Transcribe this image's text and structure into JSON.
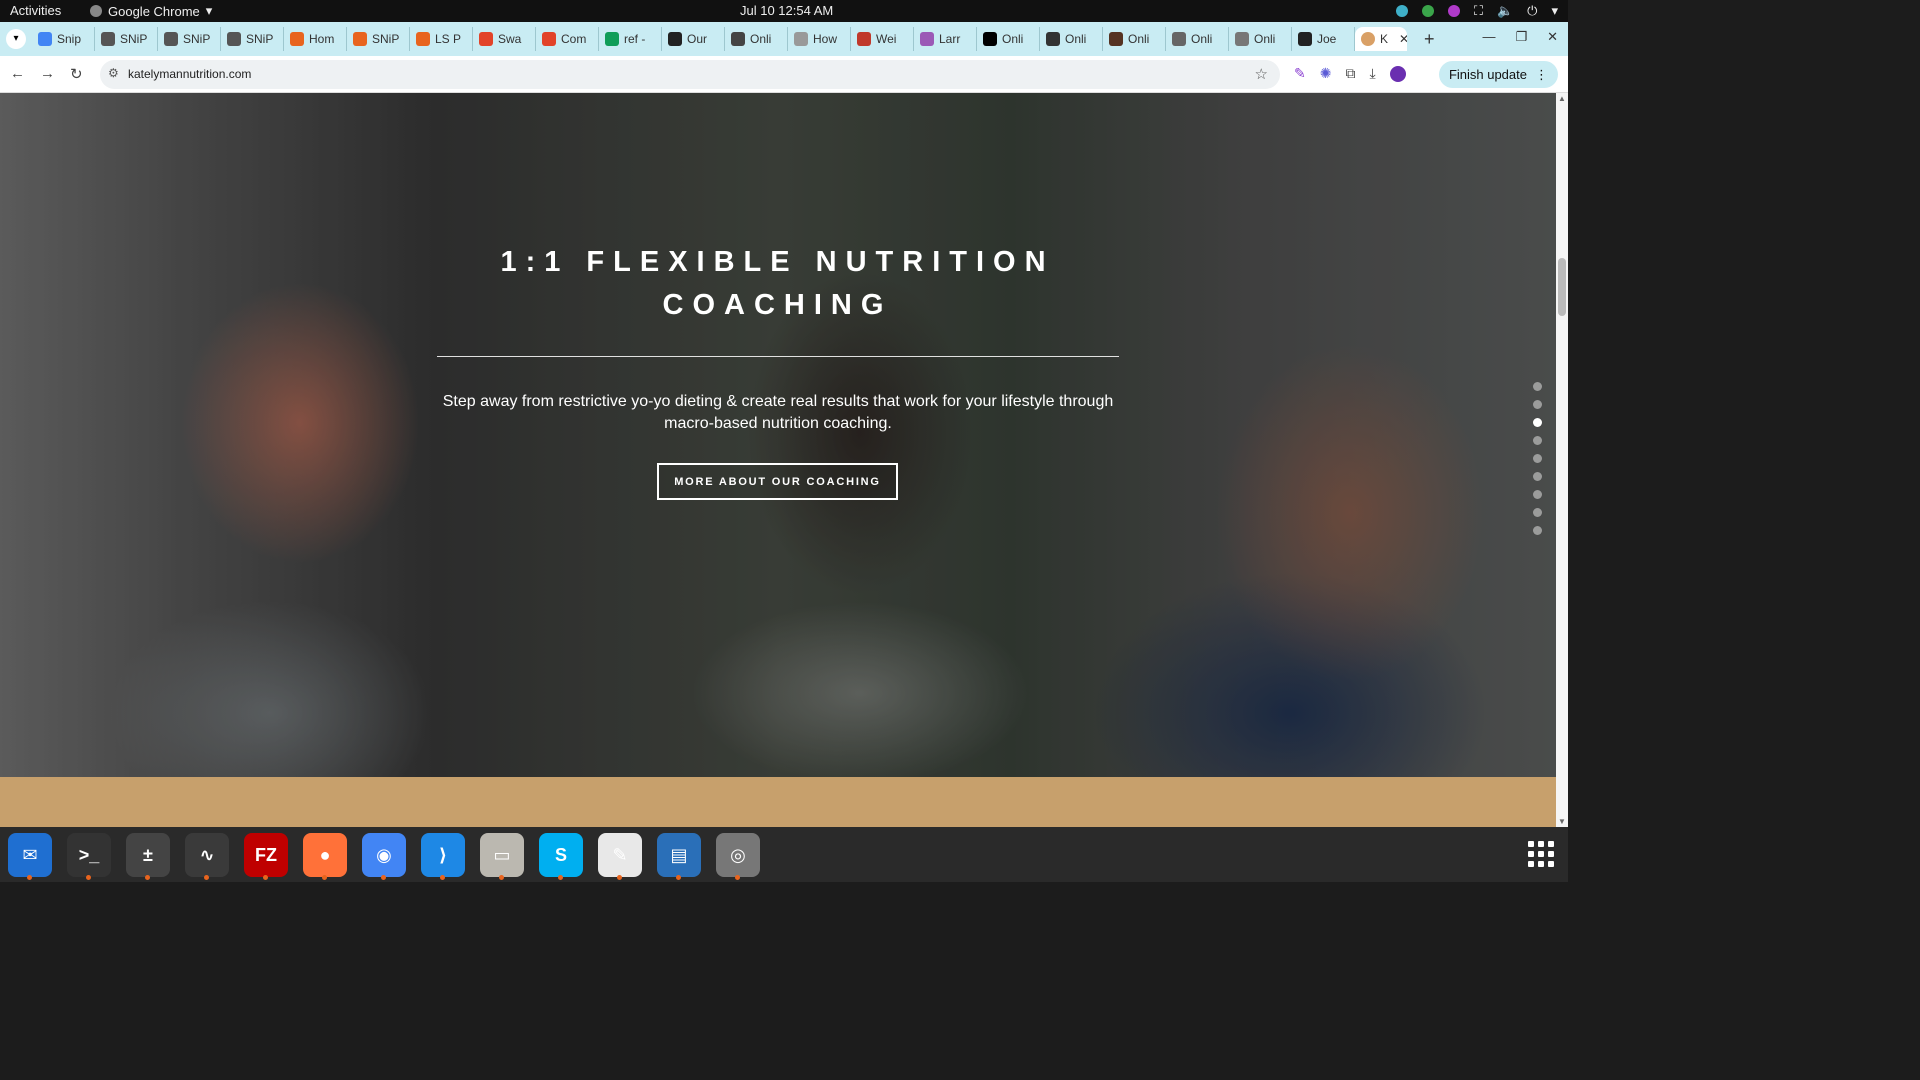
{
  "system_bar": {
    "activities": "Activities",
    "app_name": "Google Chrome",
    "clock": "Jul 10  12:54 AM"
  },
  "tabs": [
    {
      "label": "Snip",
      "color": "#4285f4"
    },
    {
      "label": "SNiP",
      "color": "#555555"
    },
    {
      "label": "SNiP",
      "color": "#555555"
    },
    {
      "label": "SNiP",
      "color": "#555555"
    },
    {
      "label": "Hom",
      "color": "#e8641e"
    },
    {
      "label": "SNiP",
      "color": "#e8641e"
    },
    {
      "label": "LS P",
      "color": "#e8641e"
    },
    {
      "label": "Swa",
      "color": "#e24329"
    },
    {
      "label": "Com",
      "color": "#e24329"
    },
    {
      "label": "ref -",
      "color": "#0f9d58"
    },
    {
      "label": "Our",
      "color": "#222222"
    },
    {
      "label": "Onli",
      "color": "#444444"
    },
    {
      "label": "How",
      "color": "#999999"
    },
    {
      "label": "Wei",
      "color": "#c0392b"
    },
    {
      "label": "Larr",
      "color": "#9b59b6"
    },
    {
      "label": "Onli",
      "color": "#000000"
    },
    {
      "label": "Onli",
      "color": "#333333"
    },
    {
      "label": "Onli",
      "color": "#553322"
    },
    {
      "label": "Onli",
      "color": "#666666"
    },
    {
      "label": "Onli",
      "color": "#777777"
    },
    {
      "label": "Joe",
      "color": "#222222"
    }
  ],
  "active_tab": {
    "label": "K",
    "color": "#d9a066"
  },
  "address_bar": {
    "url": "katelymannutrition.com"
  },
  "finish_update": "Finish update",
  "hero": {
    "title": "1:1 FLEXIBLE NUTRITION COACHING",
    "description": "Step away from restrictive yo-yo dieting & create real results that work for your lifestyle through macro-based nutrition coaching.",
    "button": "MORE ABOUT OUR COACHING"
  },
  "slide_dots": {
    "count": 9,
    "active_index": 2
  },
  "dock": [
    {
      "name": "thunderbird-icon",
      "color": "#1f6fd1",
      "glyph": "✉"
    },
    {
      "name": "terminal-icon",
      "color": "#333333",
      "glyph": ">_"
    },
    {
      "name": "calculator-icon",
      "color": "#444444",
      "glyph": "±"
    },
    {
      "name": "system-monitor-icon",
      "color": "#3a3a3a",
      "glyph": "∿"
    },
    {
      "name": "filezilla-icon",
      "color": "#bf0000",
      "glyph": "FZ"
    },
    {
      "name": "firefox-icon",
      "color": "#ff7139",
      "glyph": "●"
    },
    {
      "name": "chrome-icon",
      "color": "#4285f4",
      "glyph": "◉"
    },
    {
      "name": "vscode-icon",
      "color": "#1e88e5",
      "glyph": "⟩"
    },
    {
      "name": "files-icon",
      "color": "#bbb8b0",
      "glyph": "▭"
    },
    {
      "name": "skype-icon",
      "color": "#00aff0",
      "glyph": "S"
    },
    {
      "name": "text-editor-icon",
      "color": "#e8e8e8",
      "glyph": "✎"
    },
    {
      "name": "document-viewer-icon",
      "color": "#2a6fb8",
      "glyph": "▤"
    },
    {
      "name": "disk-icon",
      "color": "#777777",
      "glyph": "◎"
    }
  ]
}
